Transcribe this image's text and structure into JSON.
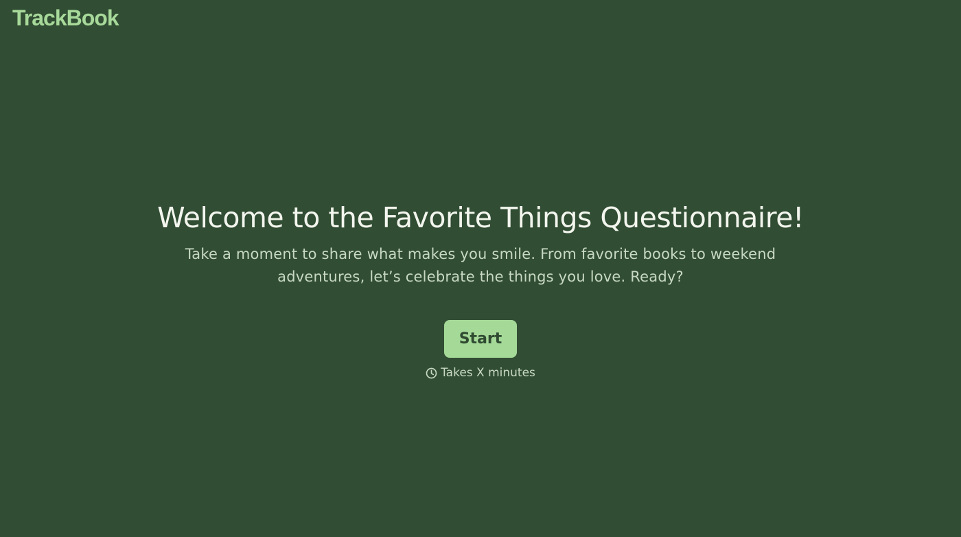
{
  "header": {
    "logo_text": "TrackBook"
  },
  "hero": {
    "title": "Welcome to the Favorite Things Questionnaire!",
    "subtitle": "Take a moment to share what makes you smile. From favorite books to weekend adventures, let’s celebrate the things you love. Ready?",
    "start_label": "Start",
    "duration_icon": "clock-icon",
    "duration_text": "Takes X minutes"
  },
  "colors": {
    "background": "#314d33",
    "accent": "#a5d998",
    "title_text": "#f3f6ee",
    "muted_text": "#c8d9c3"
  }
}
